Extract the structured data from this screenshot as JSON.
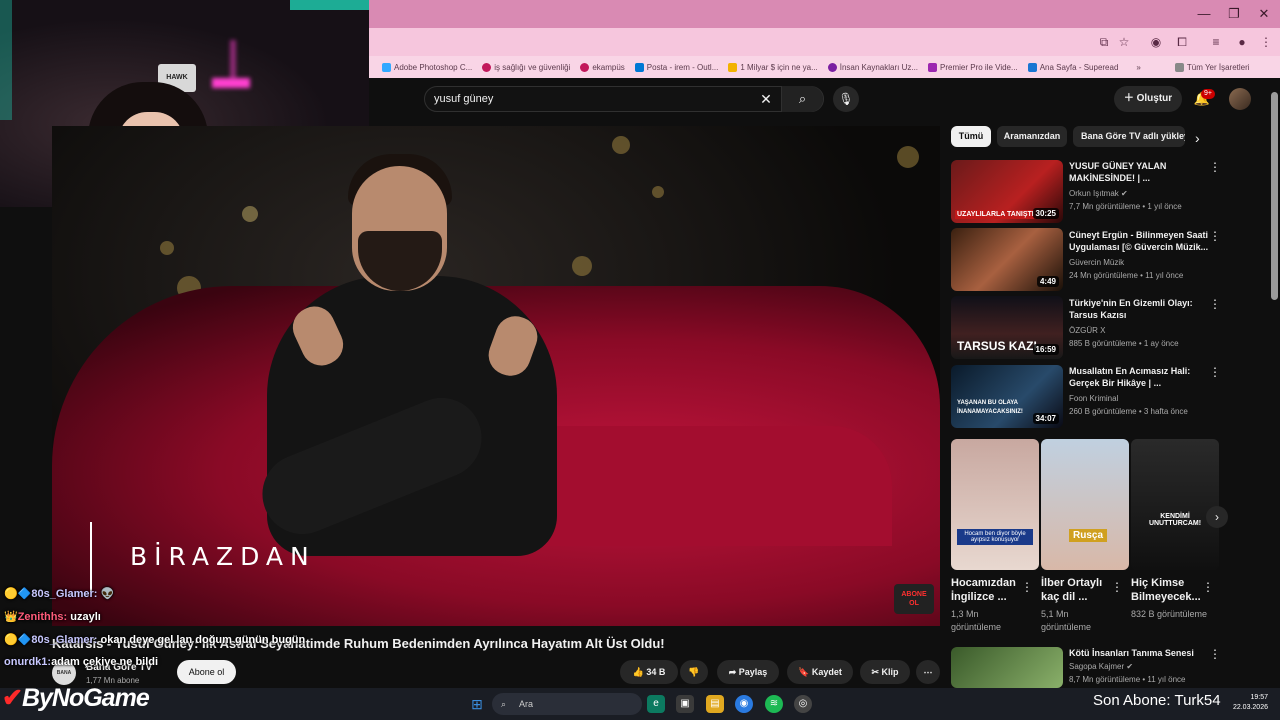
{
  "browser": {
    "bookmarks": [
      "Adobe Photoshop C...",
      "iş sağlığı ve güvenliği",
      "ekampüs",
      "Posta - irem - Outl...",
      "1 Milyar $ için ne ya...",
      "İnsan Kaynakları Uz...",
      "Premier Pro ile Vide...",
      "Ana Sayfa - Superead"
    ],
    "bookmarks_more": "»",
    "all_bookmarks": "Tüm Yer İşaretleri"
  },
  "youtube": {
    "search_value": "yusuf güney",
    "create_label": "Oluştur",
    "notification_count": "9+"
  },
  "video": {
    "overlay_text": "BİRAZDAN",
    "corner_badge_line1": "ABONE",
    "corner_badge_line2": "OL",
    "title": "Katarsis - Yusuf Güney: İlk Astral Seyahatimde Ruhum Bedenimden Ayrılınca Hayatım Alt Üst Oldu!",
    "channel_logo_text": "BANA GÖRE",
    "channel_name": "Bana Göre TV",
    "subscribers": "1,77 Mn abone",
    "subscribe_label": "Abone ol",
    "actions": {
      "like": "34 B",
      "share": "Paylaş",
      "save": "Kaydet",
      "clip": "Klip"
    }
  },
  "chat": [
    {
      "user": "80s_Glamer:",
      "message": ""
    },
    {
      "user": "Zenithhs:",
      "message": "uzaylı"
    },
    {
      "user": "80s_Glamer:",
      "message": "okan deye gel lan doğum günün bugün"
    },
    {
      "user": "onurdk1:",
      "message": "adam çekiye ne bildi"
    }
  ],
  "sidebar": {
    "chips": [
      "Tümü",
      "Aramanızdan",
      "Bana Göre TV adlı yükleyiciden"
    ],
    "videos": [
      {
        "title": "YUSUF GÜNEY YALAN MAKİNESİNDE! | ...",
        "channel": "Orkun Işıtmak",
        "verified": true,
        "meta": "7,7 Mn görüntüleme • 1 yıl önce",
        "duration": "30:25",
        "thumb_text": "UZAYLILARLA TANIŞTI"
      },
      {
        "title": "Cüneyt Ergün - Bilinmeyen Saati Uygulaması [© Güvercin Müzik...",
        "channel": "Güvercin Müzik",
        "verified": false,
        "meta": "24 Mn görüntüleme • 11 yıl önce",
        "duration": "4:49",
        "thumb_text": ""
      },
      {
        "title": "Türkiye'nin En Gizemli Olayı: Tarsus Kazısı",
        "channel": "ÖZGÜR X",
        "verified": false,
        "meta": "885 B görüntüleme • 1 ay önce",
        "duration": "16:59",
        "thumb_text": "TARSUS KAZI"
      },
      {
        "title": "Musallatın En Acımasız Hali: Gerçek Bir Hikâye | ...",
        "channel": "Foon Kriminal",
        "verified": false,
        "meta": "260 B görüntüleme • 3 hafta önce",
        "duration": "34:07",
        "thumb_text": "YAŞANAN BU OLAYA İNANAMAYACAKSINIZ!"
      }
    ],
    "shorts": [
      {
        "title": "Hocamızdan İngilizce ...",
        "views": "1,3 Mn görüntüleme",
        "caption": "Hocam ben diyor böyle ayıpsız konuşuyor"
      },
      {
        "title": "İlber Ortaylı kaç dil ...",
        "views": "5,1 Mn görüntüleme",
        "caption": "Rusça"
      },
      {
        "title": "Hiç Kimse Bilmeyecek...",
        "views": "832 B görüntüleme",
        "caption": "KENDİMİ UNUTTURCAM!"
      }
    ],
    "last_video": {
      "title": "Kötü İnsanları Tanıma Senesi",
      "channel": "Sagopa Kajmer",
      "meta": "8,7 Mn görüntüleme • 11 yıl önce"
    }
  },
  "taskbar": {
    "brand": "ByNoGame",
    "search_placeholder": "Ara",
    "stream_overlay": "Son Abone: Turk54",
    "time": "19:57",
    "date": "22.03.2026"
  },
  "webcam": {
    "bottle_label": "HAWK"
  }
}
